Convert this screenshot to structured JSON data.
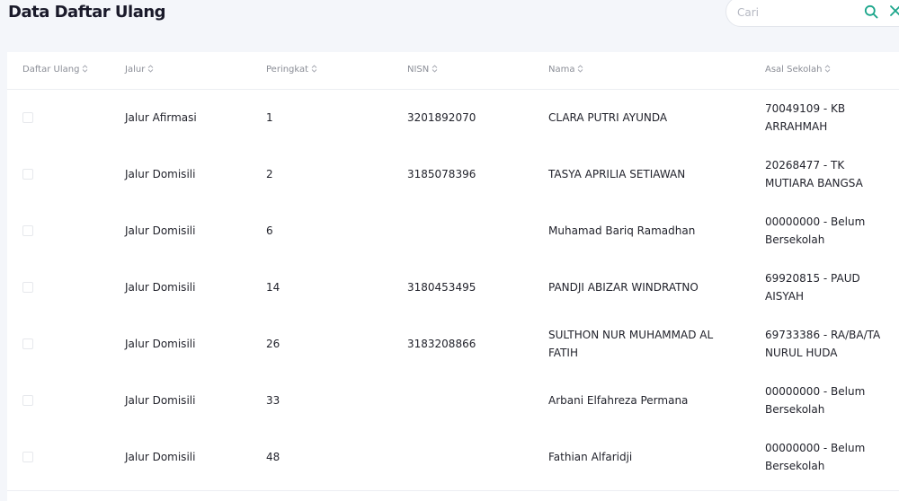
{
  "page": {
    "title": "Data Daftar Ulang"
  },
  "search": {
    "placeholder": "Cari",
    "value": ""
  },
  "colors": {
    "accent": "#1aa58a",
    "header_text": "#8a8d96",
    "background": "#f4f6fa"
  },
  "table": {
    "columns": [
      {
        "label": "Daftar Ulang"
      },
      {
        "label": "Jalur"
      },
      {
        "label": "Peringkat"
      },
      {
        "label": "NISN"
      },
      {
        "label": "Nama"
      },
      {
        "label": "Asal Sekolah"
      }
    ],
    "rows": [
      {
        "checked": false,
        "jalur": "Jalur Afirmasi",
        "peringkat": "1",
        "nisn": "3201892070",
        "nama": "CLARA PUTRI AYUNDA",
        "asal_sekolah": "70049109 - KB ARRAHMAH"
      },
      {
        "checked": false,
        "jalur": "Jalur Domisili",
        "peringkat": "2",
        "nisn": "3185078396",
        "nama": "TASYA APRILIA SETIAWAN",
        "asal_sekolah": "20268477 - TK MUTIARA BANGSA"
      },
      {
        "checked": false,
        "jalur": "Jalur Domisili",
        "peringkat": "6",
        "nisn": "",
        "nama": "Muhamad Bariq Ramadhan",
        "asal_sekolah": "00000000 - Belum Bersekolah"
      },
      {
        "checked": false,
        "jalur": "Jalur Domisili",
        "peringkat": "14",
        "nisn": "3180453495",
        "nama": "PANDJI ABIZAR WINDRATNO",
        "asal_sekolah": "69920815 - PAUD AISYAH"
      },
      {
        "checked": false,
        "jalur": "Jalur Domisili",
        "peringkat": "26",
        "nisn": "3183208866",
        "nama": "SULTHON NUR MUHAMMAD AL FATIH",
        "asal_sekolah": "69733386 - RA/BA/TA NURUL HUDA"
      },
      {
        "checked": false,
        "jalur": "Jalur Domisili",
        "peringkat": "33",
        "nisn": "",
        "nama": "Arbani Elfahreza Permana",
        "asal_sekolah": "00000000 - Belum Bersekolah"
      },
      {
        "checked": false,
        "jalur": "Jalur Domisili",
        "peringkat": "48",
        "nisn": "",
        "nama": "Fathian Alfaridji",
        "asal_sekolah": "00000000 - Belum Bersekolah"
      }
    ]
  }
}
